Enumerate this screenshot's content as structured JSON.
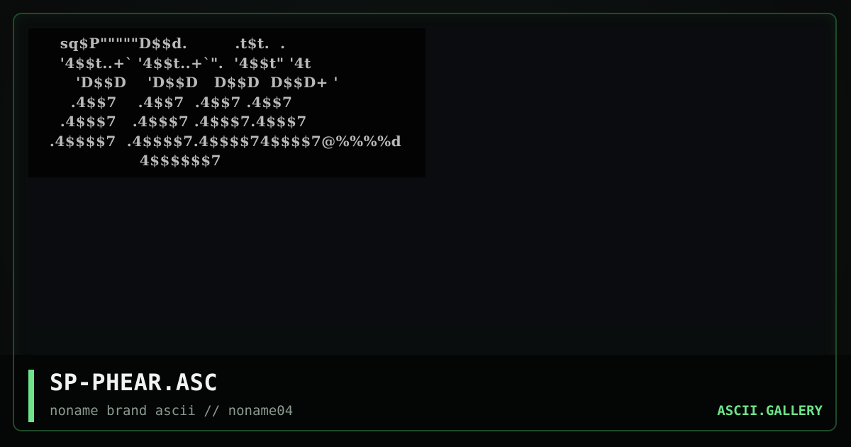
{
  "art": {
    "lines": [
      "      sq$P\"\"\"\"\"D$$d.         .t$t.  .",
      "      '4$$t..+` '4$$t..+`\".  '4$$t\" '4t",
      "         'D$$D    'D$$D   D$$D  D$$D+ '",
      "        .4$$7    .4$$7  .4$$7 .4$$7",
      "      .4$$$7   .4$$$7 .4$$$7.4$$$7",
      "    .4$$$$7  .4$$$$7.4$$$$74$$$$7@%%%%d",
      "                     4$$$$$$7"
    ]
  },
  "file": {
    "title": "SP-PHEAR.ASC",
    "subtitle": "noname brand ascii // noname04"
  },
  "brand": {
    "label": "ASCII.GALLERY"
  },
  "colors": {
    "accent": "#6ee38a",
    "border": "#1f4a2a",
    "art_fg": "#b9b9b9",
    "art_bg": "#030303"
  }
}
